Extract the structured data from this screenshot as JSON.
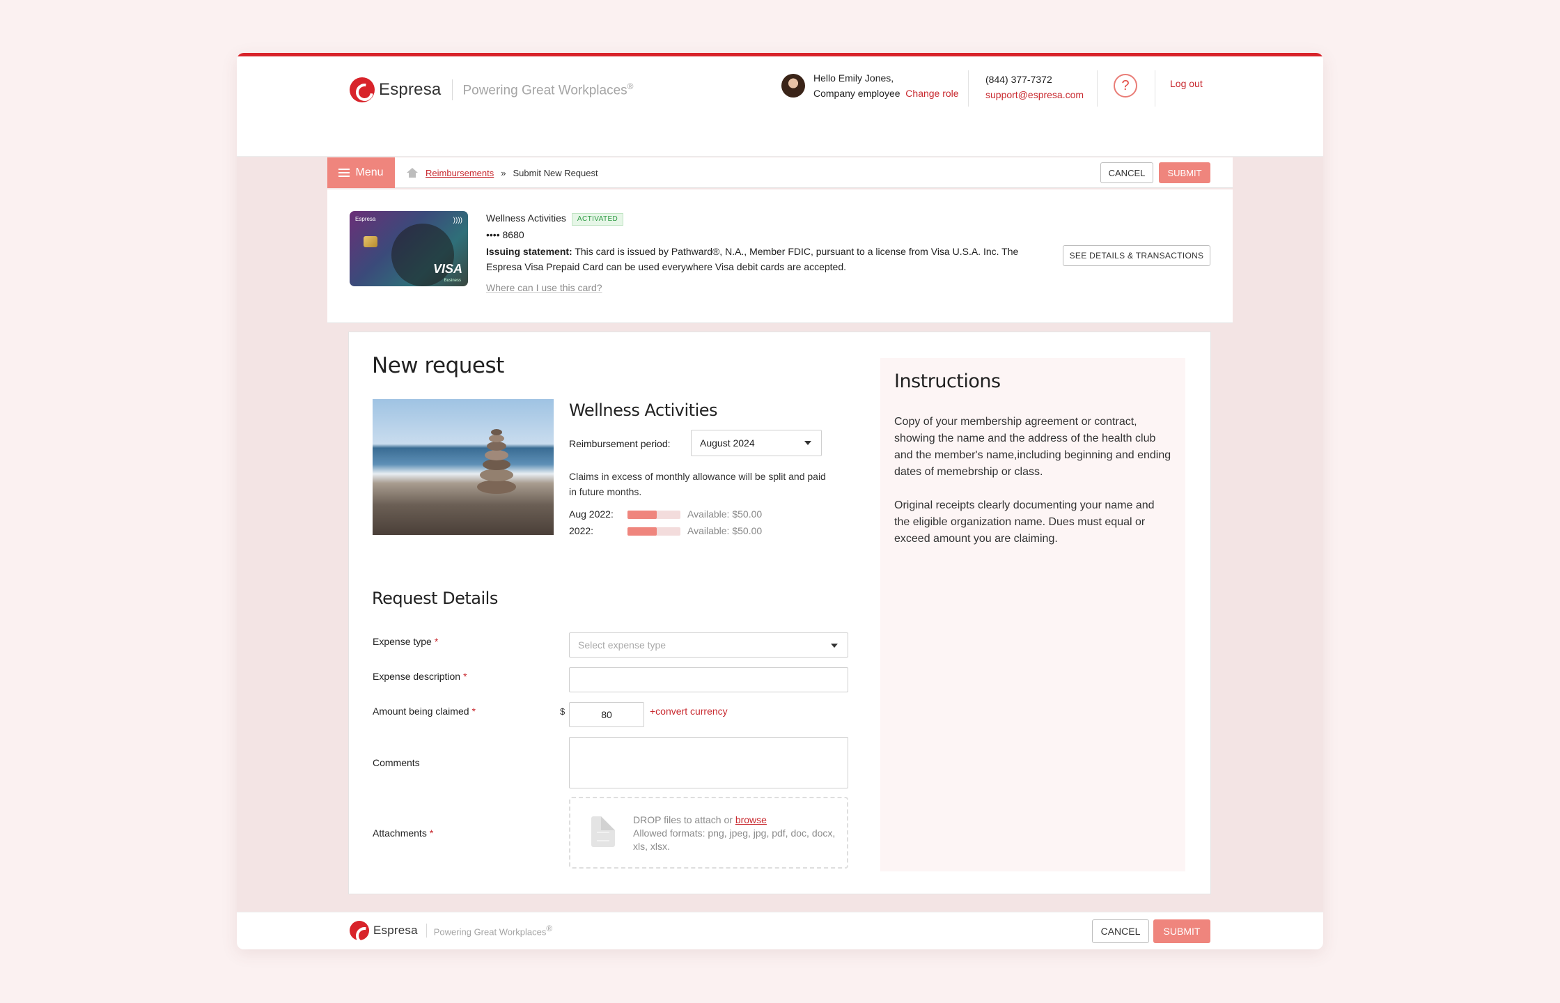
{
  "brand": {
    "name": "Espresa",
    "tagline": "Powering Great Workplaces",
    "reg": "®"
  },
  "user": {
    "greeting": "Hello Emily Jones,",
    "role": "Company employee",
    "change_role": "Change role"
  },
  "support": {
    "phone": "(844) 377-7372",
    "email": "support@espresa.com"
  },
  "help_label": "?",
  "logout": "Log out",
  "toolbar": {
    "menu": "Menu",
    "crumb_link": "Reimbursements",
    "crumb_sep": "»",
    "crumb_current": "Submit New Request",
    "cancel": "CANCEL",
    "submit": "SUBMIT"
  },
  "card": {
    "brand": "Espresa",
    "network": "VISA",
    "network_sub": "Business",
    "nfc": "))))",
    "title": "Wellness Activities",
    "status": "ACTIVATED",
    "number": "•••• 8680",
    "issuing_label": "Issuing statement:",
    "issuing_text": "This card is issued by Pathward®, N.A., Member FDIC, pursuant to a license from Visa U.S.A. Inc. The Espresa Visa Prepaid Card can be used everywhere Visa debit cards are accepted.",
    "where_link": "Where can I use this card?",
    "details_button": "SEE DETAILS & TRANSACTIONS"
  },
  "request": {
    "title": "New request",
    "program": "Wellness Activities",
    "period_label": "Reimbursement period:",
    "period_value": "August 2024",
    "claims_note": "Claims in excess of monthly allowance will be split and paid in future months.",
    "allowances": [
      {
        "label": "Aug 2022:",
        "available": "Available: $50.00",
        "used_fraction": 0.55
      },
      {
        "label": "2022:",
        "available": "Available: $50.00",
        "used_fraction": 0.55
      }
    ]
  },
  "details": {
    "title": "Request Details",
    "expense_type_label": "Expense type",
    "expense_type_placeholder": "Select expense type",
    "expense_desc_label": "Expense description",
    "amount_label": "Amount being claimed",
    "currency_symbol": "$",
    "amount_value": "80",
    "convert": "+convert currency",
    "comments_label": "Comments",
    "attachments_label": "Attachments",
    "required_mark": "*",
    "drop_text": "DROP files to attach or",
    "browse": "browse",
    "formats": "Allowed formats: png, jpeg, jpg, pdf, doc, docx, xls, xlsx."
  },
  "instructions": {
    "title": "Instructions",
    "p1": "Copy of your membership agreement or contract, showing the name and the address of the health club and the member's name,including beginning and ending dates of memebrship or class.",
    "p2": "Original receipts clearly documenting your name and the eligible organization name. Dues must equal or exceed amount you are claiming."
  },
  "footer": {
    "cancel": "CANCEL",
    "submit": "SUBMIT"
  },
  "colors": {
    "accent": "#d8232a",
    "button": "#ef857d",
    "status_green": "#2e9a44"
  }
}
